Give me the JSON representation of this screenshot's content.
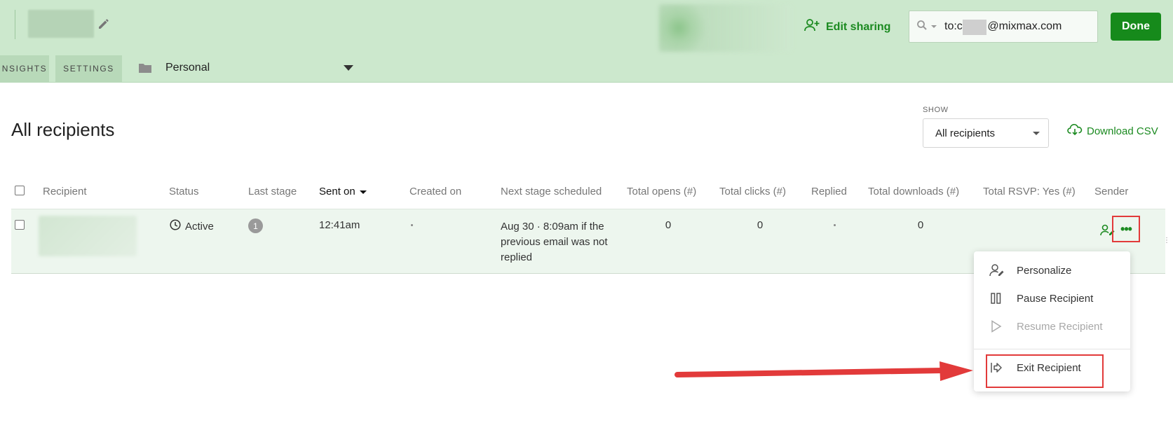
{
  "header": {
    "edit_sharing_label": "Edit sharing",
    "search_value": "to:c        @mixmax.com",
    "done_label": "Done",
    "tabs": [
      {
        "label": "NSIGHTS"
      },
      {
        "label": "SETTINGS"
      }
    ],
    "folder": {
      "icon": "folder-icon",
      "label": "Personal"
    }
  },
  "main": {
    "title": "All recipients",
    "show_label": "SHOW",
    "show_value": "All recipients",
    "download_label": "Download CSV"
  },
  "table": {
    "columns": [
      "Recipient",
      "Status",
      "Last stage",
      "Sent on",
      "Created on",
      "Next stage scheduled",
      "Total opens (#)",
      "Total clicks (#)",
      "Replied",
      "Total downloads (#)",
      "Total RSVP: Yes (#)",
      "Sender"
    ],
    "rows": [
      {
        "status": "Active",
        "last_stage": "1",
        "sent_on": "12:41am",
        "created_on": "·",
        "next_stage": "Aug 30 · 8:09am if the previous email was not replied",
        "total_opens": "0",
        "total_clicks": "0",
        "replied": "·",
        "total_downloads": "0"
      }
    ]
  },
  "menu": {
    "items": [
      {
        "label": "Personalize",
        "icon": "person-edit-icon",
        "enabled": true
      },
      {
        "label": "Pause Recipient",
        "icon": "pause-icon",
        "enabled": true
      },
      {
        "label": "Resume Recipient",
        "icon": "play-icon",
        "enabled": false
      },
      {
        "label": "Exit Recipient",
        "icon": "exit-icon",
        "enabled": true
      }
    ]
  },
  "colors": {
    "header_bg": "#cce8cd",
    "accent_green": "#1b8a20",
    "done_bg": "#168a1b",
    "highlight_red": "#e23a3a",
    "row_bg": "#edf6ee"
  }
}
